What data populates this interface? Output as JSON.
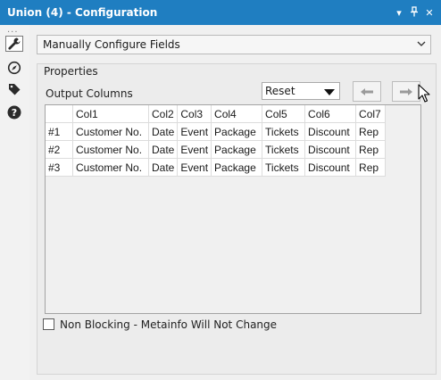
{
  "window": {
    "title": "Union (4) - Configuration",
    "controls": [
      "▾",
      "⊥",
      "✕"
    ]
  },
  "toolbar": {
    "dots": "...",
    "icons": [
      "wrench-icon",
      "compass-icon",
      "tag-icon",
      "help-icon"
    ]
  },
  "config": {
    "mode_select": "Manually Configure Fields"
  },
  "properties": {
    "label": "Properties",
    "output_columns_label": "Output Columns",
    "reset_select": "Reset",
    "move_left_label": "←",
    "move_right_label": "→"
  },
  "grid": {
    "headers": [
      "",
      "Col1",
      "Col2",
      "Col3",
      "Col4",
      "Col5",
      "Col6",
      "Col7"
    ],
    "rows": [
      [
        "#1",
        "Customer No.",
        "Date",
        "Event",
        "Package",
        "Tickets",
        "Discount",
        "Rep"
      ],
      [
        "#2",
        "Customer No.",
        "Date",
        "Event",
        "Package",
        "Tickets",
        "Discount",
        "Rep"
      ],
      [
        "#3",
        "Customer No.",
        "Date",
        "Event",
        "Package",
        "Tickets",
        "Discount",
        "Rep"
      ]
    ]
  },
  "options": {
    "non_blocking_label": "Non Blocking - Metainfo Will Not Change",
    "non_blocking_checked": false
  },
  "colors": {
    "title_bar": "#1f7ec1",
    "panel_bg": "#f0f0f0"
  }
}
